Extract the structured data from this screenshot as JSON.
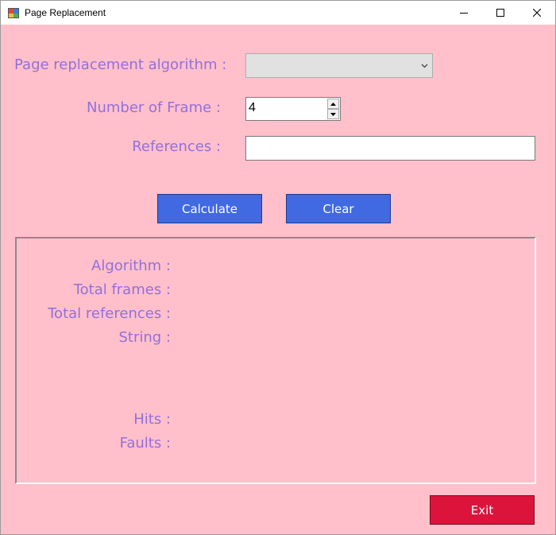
{
  "window": {
    "title": "Page Replacement",
    "controls": {
      "minimize": "minimize-icon",
      "maximize": "maximize-icon",
      "close": "close-icon"
    }
  },
  "form": {
    "algorithm_label": "Page replacement algorithm :",
    "algorithm_selected": "",
    "frames_label": "Number of Frame :",
    "frames_value": "4",
    "references_label": "References :",
    "references_value": ""
  },
  "actions": {
    "calculate_label": "Calculate",
    "clear_label": "Clear",
    "exit_label": "Exit"
  },
  "results": {
    "algorithm_label": "Algorithm :",
    "total_frames_label": "Total frames :",
    "total_references_label": "Total references :",
    "string_label": "String :",
    "hits_label": "Hits :",
    "faults_label": "Faults :"
  },
  "colors": {
    "background": "#ffc0cb",
    "label_text": "#9370db",
    "primary_button": "#4169e1",
    "exit_button": "#dc143c"
  }
}
